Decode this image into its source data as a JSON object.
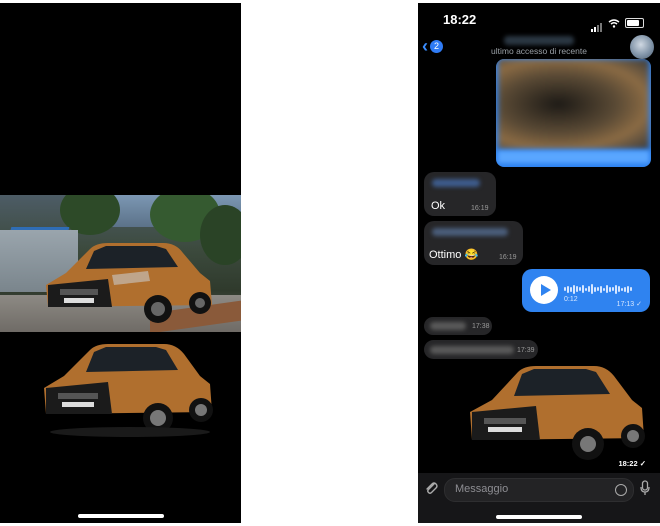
{
  "chat": {
    "time": "18:22",
    "back_badge": "2",
    "last_seen": "ultimo accesso di recente",
    "input_placeholder": "Messaggio",
    "messages": [
      {
        "text": "Ok",
        "time": "16:19"
      },
      {
        "text": "Ottimo 😂",
        "time": "16:19"
      },
      {
        "duration": "0:12",
        "time": "17:13 ✓"
      },
      {
        "time": "17:38"
      },
      {
        "time": "17:39"
      },
      {
        "time": "18:22 ✓"
      }
    ]
  },
  "colors": {
    "accent": "#2f83f0",
    "incoming_bubble": "#262628",
    "car_body": "#b06f2e"
  },
  "icons": [
    "chevron-left-icon",
    "paperclip-icon",
    "sticker-icon",
    "microphone-icon",
    "play-icon",
    "wifi-icon",
    "battery-icon",
    "signal-icon"
  ]
}
